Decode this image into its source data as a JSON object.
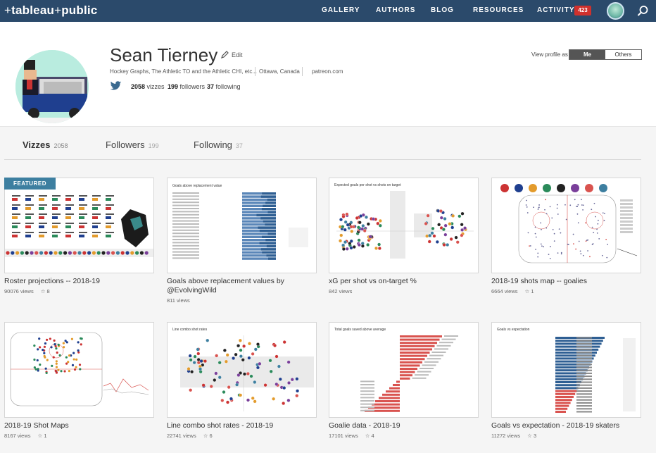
{
  "nav": {
    "logo_main": "tableau",
    "logo_plus": "+",
    "logo_sub": "public",
    "items": [
      "GALLERY",
      "AUTHORS",
      "BLOG",
      "RESOURCES",
      "ACTIVITY"
    ],
    "activity_count": "423",
    "icons": {
      "search": "search-icon",
      "avatar": "user-avatar"
    }
  },
  "profile": {
    "name": "Sean Tierney",
    "edit_label": "Edit",
    "bio": "Hockey Graphs, The Athletic TO and the Athletic CHI, etc...",
    "location": "Ottawa, Canada",
    "website": "patreon.com",
    "vizzes_count": "2058",
    "vizzes_label": "vizzes",
    "followers_count": "199",
    "followers_label": "followers",
    "following_count": "37",
    "following_label": "following",
    "view_as_label": "View profile as",
    "view_me": "Me",
    "view_others": "Others"
  },
  "tabs": [
    {
      "label": "Vizzes",
      "count": "2058"
    },
    {
      "label": "Followers",
      "count": "199"
    },
    {
      "label": "Following",
      "count": "37"
    }
  ],
  "featured_label": "FEATURED",
  "vizzes": [
    {
      "title": "Roster projections -- 2018-19",
      "views": "90076 views",
      "favs": "8",
      "thumb_title": "",
      "kind": "roster"
    },
    {
      "title": "Goals above replacement values by @EvolvingWild",
      "views": "811 views",
      "favs": "",
      "thumb_title": "Goals above replacement value",
      "kind": "hbar"
    },
    {
      "title": "xG per shot vs on-target %",
      "views": "842 views",
      "favs": "",
      "thumb_title": "Expected goals per shot vs shots on target",
      "kind": "scatter"
    },
    {
      "title": "2018-19 shots map -- goalies",
      "views": "6664 views",
      "favs": "1",
      "thumb_title": "",
      "kind": "rink"
    },
    {
      "title": "2018-19 Shot Maps",
      "views": "8167 views",
      "favs": "1",
      "thumb_title": "",
      "kind": "rink2"
    },
    {
      "title": "Line combo shot rates - 2018-19",
      "views": "22741 views",
      "favs": "6",
      "thumb_title": "Line combo shot rates",
      "kind": "scatter"
    },
    {
      "title": "Goalie data - 2018-19",
      "views": "17101 views",
      "favs": "4",
      "thumb_title": "Total goals saved above average",
      "kind": "hbar2"
    },
    {
      "title": "Goals vs expectation - 2018-19 skaters",
      "views": "11272 views",
      "favs": "3",
      "thumb_title": "Goals vs expectation",
      "kind": "hbar3"
    }
  ],
  "colors": {
    "nav_bg": "#2b4a6b",
    "badge": "#d0312d",
    "featured": "#3d7fa0",
    "bar_blue": "#2f5f93",
    "bar_red": "#d9534f"
  }
}
